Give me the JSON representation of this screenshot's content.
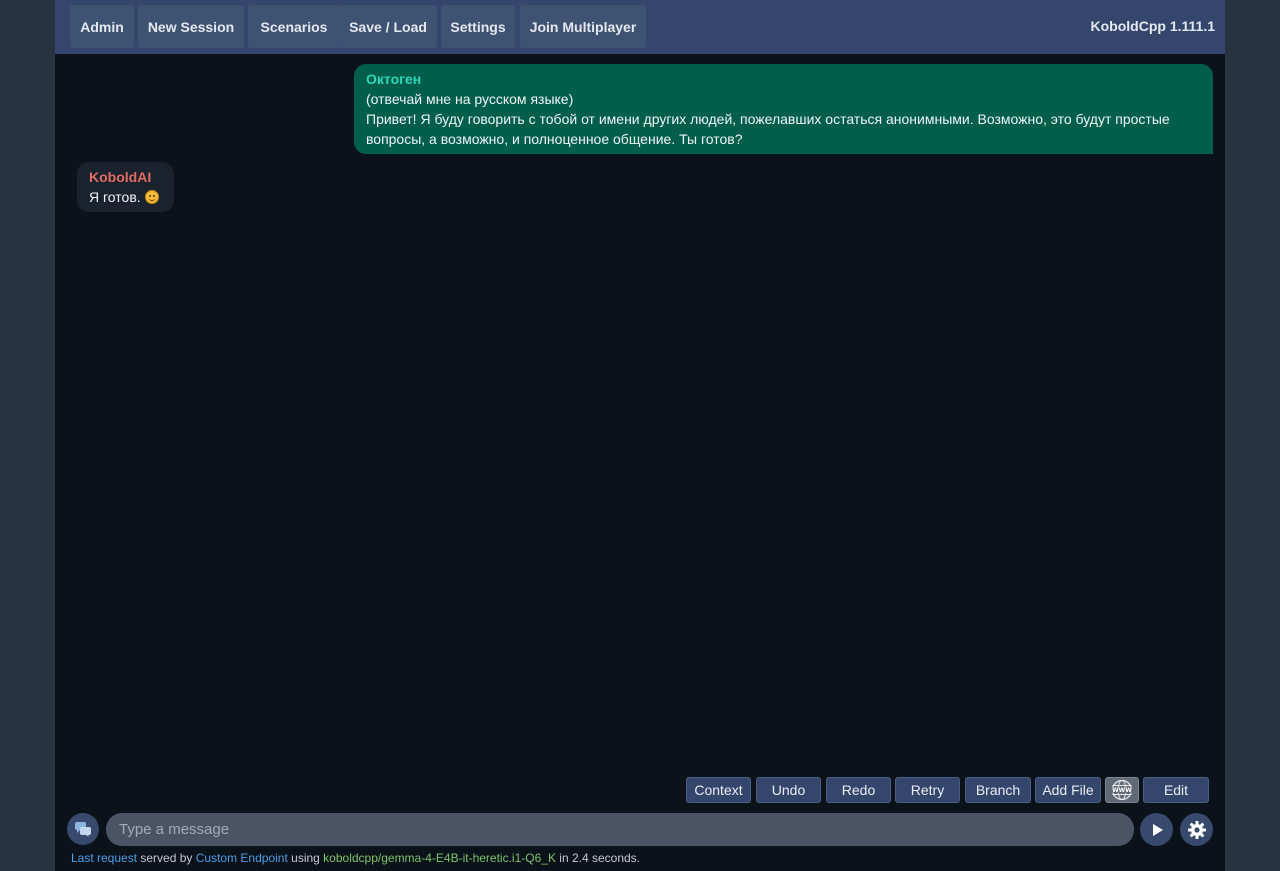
{
  "nav": {
    "items": [
      {
        "label": "Admin"
      },
      {
        "label": "New Session"
      },
      {
        "label": "Scenarios"
      },
      {
        "label": "Save / Load"
      },
      {
        "label": "Settings"
      },
      {
        "label": "Join Multiplayer"
      }
    ],
    "brand": "KoboldCpp 1.111.1"
  },
  "messages": [
    {
      "speaker": "Октоген",
      "lines": [
        "(отвечай мне на русском языке)",
        "Привет! Я буду говорить с тобой от имени других людей, пожелавших остаться анонимными. Возможно, это будут простые вопросы, а возможно, и полноценное общение. Ты готов?"
      ]
    },
    {
      "speaker": "KoboldAI",
      "text": "Я готов."
    }
  ],
  "actions": {
    "context": "Context",
    "undo": "Undo",
    "redo": "Redo",
    "retry": "Retry",
    "branch": "Branch",
    "add_file": "Add File",
    "www": "WWW",
    "edit": "Edit"
  },
  "input": {
    "placeholder": "Type a message"
  },
  "status": {
    "last_request": "Last request",
    "served_by": " served by ",
    "endpoint": "Custom Endpoint",
    "using": " using ",
    "model": "koboldcpp/gemma-4-E4B-it-heretic.i1-Q6_K",
    "in": " in 2.4 seconds."
  },
  "colors": {
    "topbar": "#34466c",
    "background": "#0b1219",
    "user_bubble": "#005e4b",
    "ai_bubble": "#1a232d",
    "user_name": "#30d7b5",
    "ai_name": "#e26c62"
  }
}
